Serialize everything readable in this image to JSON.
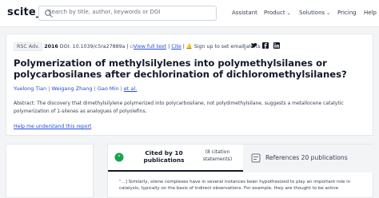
{
  "header": {
    "logo": "scite_",
    "search_placeholder": "Search by title, author, keywords or DOI",
    "nav": {
      "assistant": "Assistant",
      "product": "Product",
      "solutions": "Solutions",
      "pricing": "Pricing",
      "help": "Help"
    }
  },
  "paper": {
    "journal_badge": "RSC Adv.",
    "year": "2016",
    "doi": "DOI: 10.1039/c5ra27889a",
    "view_full_text": "View full text",
    "cite": "Cite",
    "alert_text": "Sign up to set email alerts",
    "title": "Polymerization of methylsilylenes into polymethylsilanes or polycarbosilanes after dechlorination of dichloromethylsilanes?",
    "authors": [
      "Yuelong Tian",
      "Weigang Zhang",
      "Gao Min"
    ],
    "et_al": "et al.",
    "abstract": "Abstract: The discovery that dimethylsilylene polymerized into polycarbosilane, not polydimethylsilane, suggests a metallocene catalytic polymerization of 1-silenes as analogues of polyolefins.",
    "help_link": "Help me understand this report"
  },
  "tabs": {
    "cited_by": "Cited by 10 publications",
    "citation_statements": "(8 citation statements)",
    "references": "References 20 publications"
  },
  "snippet": {
    "lead": "\"...",
    "text": "] Similarly, silene complexes have in several instances been hypothesized to play an important role in catalysis, typically on the basis of indirect observations. For example, they are thought to be active"
  },
  "colors": {
    "link": "#1d4ed8",
    "text": "#1f2937",
    "accent_green": "#16a34a"
  }
}
